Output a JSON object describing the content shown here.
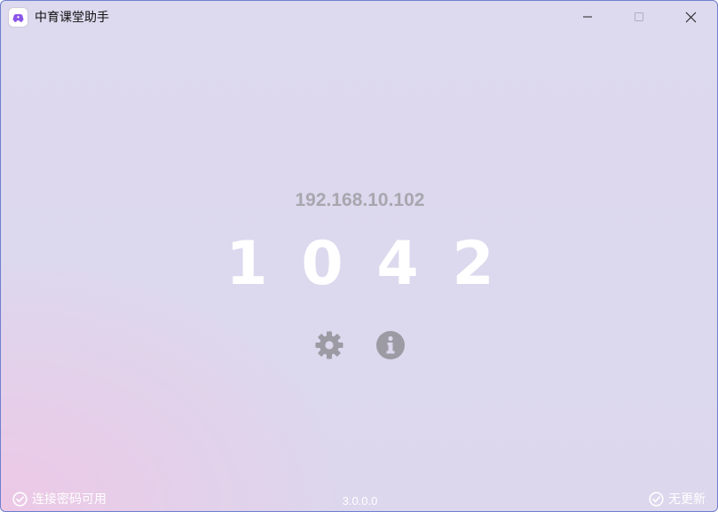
{
  "window": {
    "title": "中育课堂助手",
    "app_icon": "purple-car-logo-icon",
    "controls": [
      "minimize-icon",
      "maximize-icon",
      "close-icon"
    ]
  },
  "main": {
    "ip_address": "192.168.10.102",
    "code_digits": [
      "1",
      "0",
      "4",
      "2"
    ],
    "actions": [
      "gear-icon",
      "info-icon"
    ]
  },
  "footer": {
    "status_left": "连接密码可用",
    "version": "3.0.0.0",
    "status_right": "无更新"
  },
  "colors": {
    "accent": "#8a56e8",
    "muted_text": "#a8a6ae",
    "icon_gray": "#9c9aa3",
    "background": "#dcd7ed",
    "background_tint": "#ecc8e6"
  }
}
